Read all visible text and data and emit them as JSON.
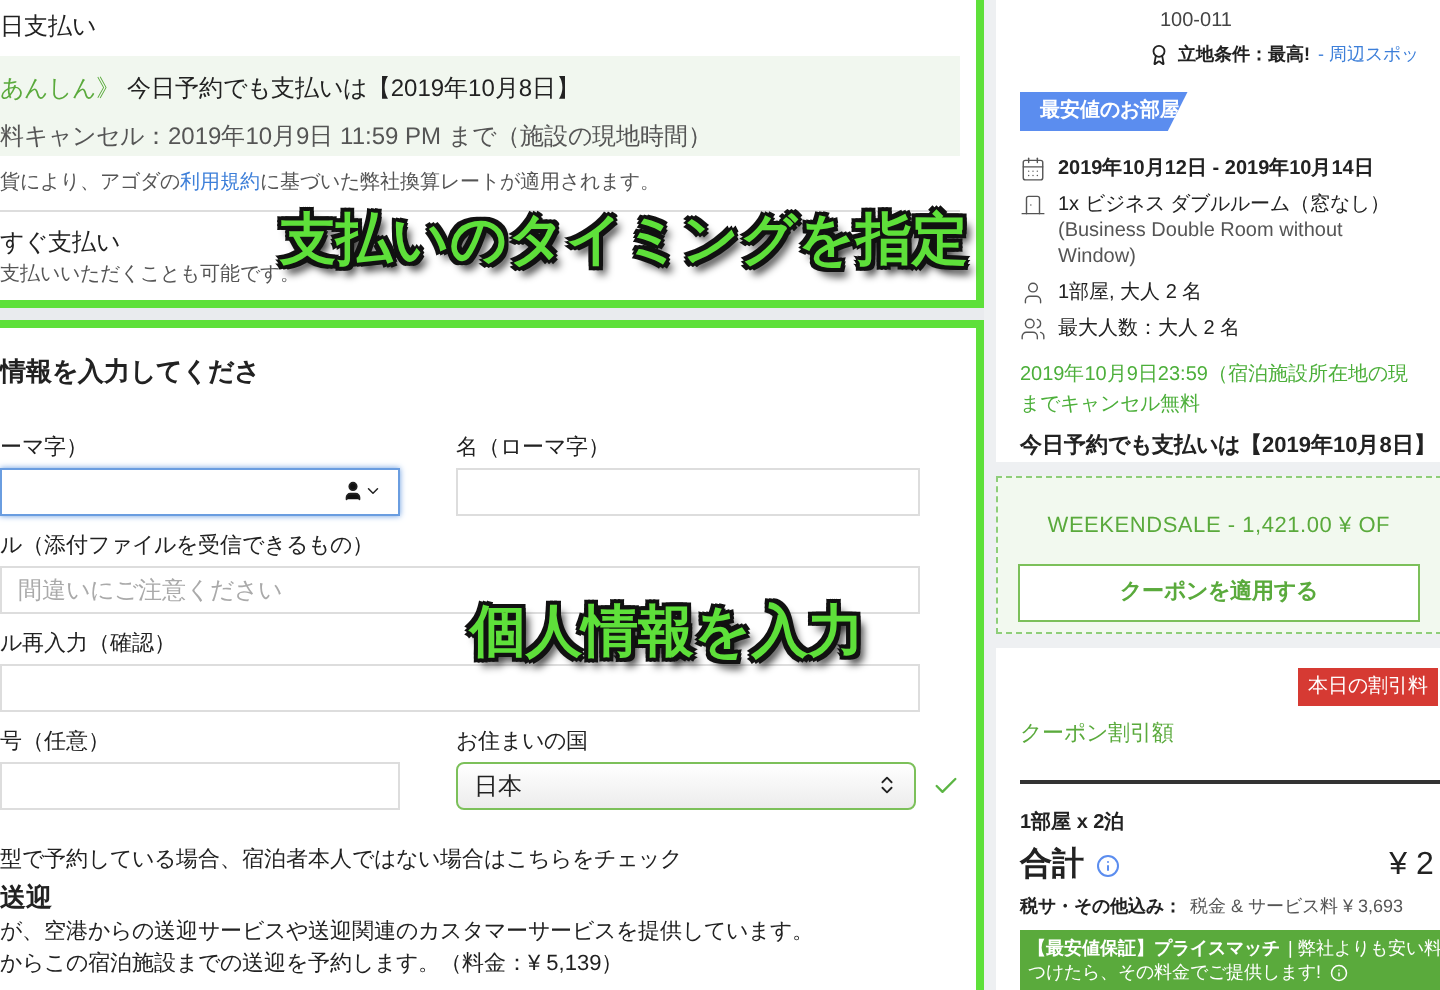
{
  "payment": {
    "title": "日支払い",
    "notice": {
      "brand": "あんしん》",
      "pay_date": "今日予約でも支払いは【2019年10月8日】",
      "cancel": "料キャンセル：2019年10月9日 11:59 PM まで（施設の現地時間）"
    },
    "rate_note": {
      "before": "貨により、アゴダの",
      "link": "利用規約",
      "after": "に基づいた弊社換算レートが適用されます。"
    },
    "option": {
      "title": "すぐ支払い",
      "subtitle": "支払いいただくことも可能です。"
    },
    "caption": "支払いのタイミングを指定"
  },
  "guest_form": {
    "heading": "情報を入力してくださ",
    "fields": [
      {
        "label": "ーマ字）",
        "kind": "name",
        "focused": true
      },
      {
        "label": "名（ローマ字）",
        "kind": "text",
        "focused": false
      },
      {
        "label": "ル（添付ファイルを受信できるもの）",
        "kind": "wide",
        "focused": false,
        "placeholder": "間違いにご注意ください"
      },
      {
        "label": "ル再入力（確認）",
        "kind": "wide",
        "focused": false
      },
      {
        "label": "号（任意）",
        "kind": "text",
        "focused": false
      },
      {
        "label": "お住まいの国",
        "kind": "select",
        "value": "日本",
        "valid": true
      }
    ],
    "check_text": "型で予約している場合、宿泊者本人ではない場合はこちらをチェック",
    "transfer_heading": "送迎",
    "transfer_text": "が、空港からの送迎サービスや送迎関連のカスタマーサービスを提供しています。",
    "transfer_option": "からこの宿泊施設までの送迎を予約します。（料金：¥ 5,139）",
    "caption": "個人情報を入力"
  },
  "hotel": {
    "postcode": "100-011",
    "location_label": "立地条件：最高!",
    "location_link": "- 周辺スポッ",
    "tag": "最安値のお部屋",
    "details": [
      {
        "kind": "calendar",
        "lines": [
          "2019年10月12日 - 2019年10月14日"
        ]
      },
      {
        "kind": "room",
        "lines": [
          "1x ビジネス ダブルルーム（窓なし）",
          "(Business Double Room without",
          "Window)"
        ]
      },
      {
        "kind": "person",
        "lines": [
          "1部屋, 大人 2 名"
        ]
      },
      {
        "kind": "group",
        "lines": [
          "最大人数：大人 2 名"
        ]
      }
    ],
    "free_cancel": [
      "2019年10月9日23:59（宿泊施設所在地の現",
      "までキャンセル無料"
    ],
    "pay_date": "今日予約でも支払いは【2019年10月8日】"
  },
  "coupon": {
    "code": "WEEKENDSALE - 1,421.00 ¥ OF",
    "button": "クーポンを適用する"
  },
  "price": {
    "badge": "本日の割引料",
    "coupon_label": "クーポン割引額",
    "rooms": "1部屋 x 2泊",
    "total_label": "合計",
    "total": "¥ 2",
    "tax_label": "税サ・その他込み：",
    "tax": "税金 & サービス料 ¥ 3,693",
    "guarantee_title": "【最安値保証】プライスマッチ",
    "guarantee_text": "| 弊社よりも安い料",
    "guarantee_line2": "つけたら、その料金でご提供します!"
  }
}
